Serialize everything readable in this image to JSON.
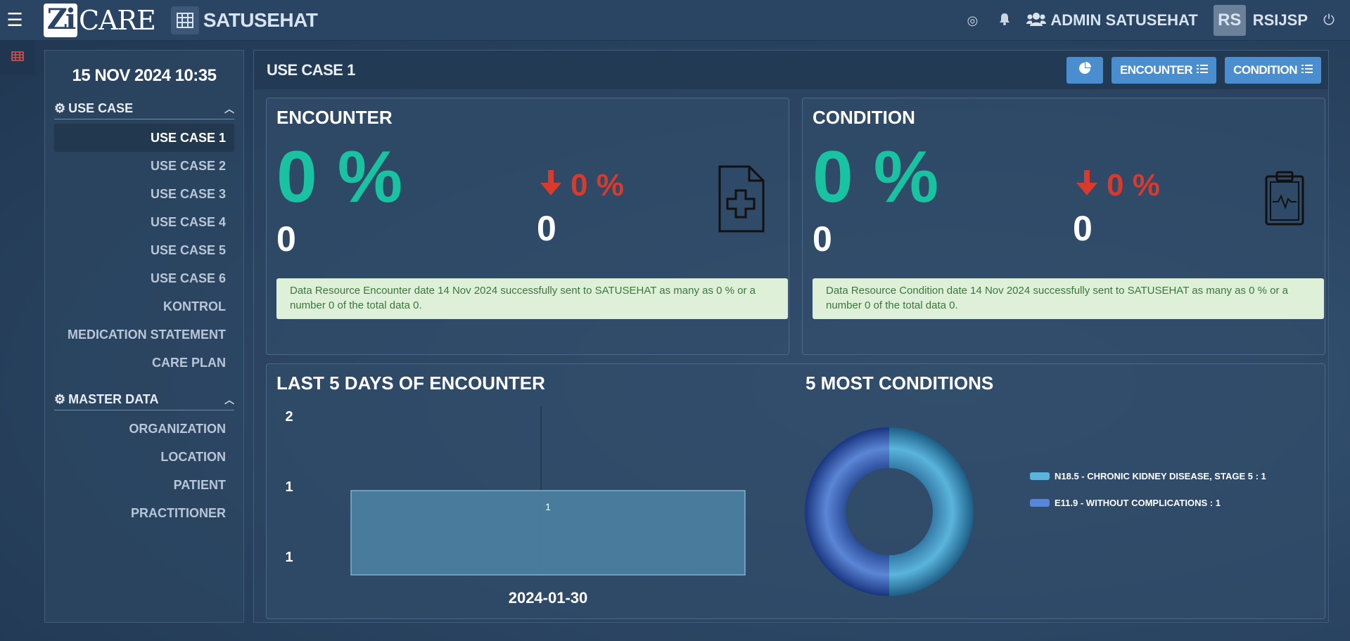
{
  "topbar": {
    "logo_text_1": "Zi",
    "logo_text_2": "CARE",
    "app_title": "SATUSEHAT",
    "user_name": "ADMIN SATUSEHAT",
    "org_initials": "RS",
    "org_name": "RSIJSP"
  },
  "sidebar": {
    "datetime": "15 NOV 2024 10:35",
    "sections": [
      {
        "title": "USE CASE",
        "items": [
          "USE CASE 1",
          "USE CASE 2",
          "USE CASE 3",
          "USE CASE 4",
          "USE CASE 5",
          "USE CASE 6",
          "KONTROL",
          "MEDICATION STATEMENT",
          "CARE PLAN"
        ]
      },
      {
        "title": "MASTER DATA",
        "items": [
          "ORGANIZATION",
          "LOCATION",
          "PATIENT",
          "PRACTITIONER"
        ]
      }
    ],
    "active_item": "USE CASE 1"
  },
  "main": {
    "title": "USE CASE 1",
    "btn_encounter": "ENCOUNTER",
    "btn_condition": "CONDITION"
  },
  "encounter_card": {
    "title": "ENCOUNTER",
    "percent": "0 %",
    "count": "0",
    "delta_percent": "0 %",
    "delta_count": "0",
    "message": "Data Resource Encounter date 14 Nov 2024 successfully sent to SATUSEHAT as many as 0 % or a number 0 of the total data 0."
  },
  "condition_card": {
    "title": "CONDITION",
    "percent": "0 %",
    "count": "0",
    "delta_percent": "0 %",
    "delta_count": "0",
    "message": "Data Resource Condition date 14 Nov 2024 successfully sent to SATUSEHAT as many as 0 % or a number 0 of the total data 0."
  },
  "charts": {
    "bar_title": "LAST 5 DAYS OF ENCOUNTER",
    "donut_title": "5 MOST CONDITIONS"
  },
  "chart_data": [
    {
      "type": "bar",
      "title": "LAST 5 DAYS OF ENCOUNTER",
      "categories": [
        "2024-01-30"
      ],
      "values": [
        1
      ],
      "data_labels": [
        "1"
      ],
      "y_tick_labels": [
        "2",
        "1",
        "1"
      ],
      "color": "#4d85a6"
    },
    {
      "type": "pie",
      "variant": "donut",
      "title": "5 MOST CONDITIONS",
      "series": [
        {
          "label": "N18.5 - CHRONIC KIDNEY DISEASE, STAGE 5",
          "value": 1,
          "color": "#5ab4dc"
        },
        {
          "label": "E11.9 - WITHOUT COMPLICATIONS",
          "value": 1,
          "color": "#5b86d6"
        }
      ],
      "legend_placement": "right"
    }
  ]
}
